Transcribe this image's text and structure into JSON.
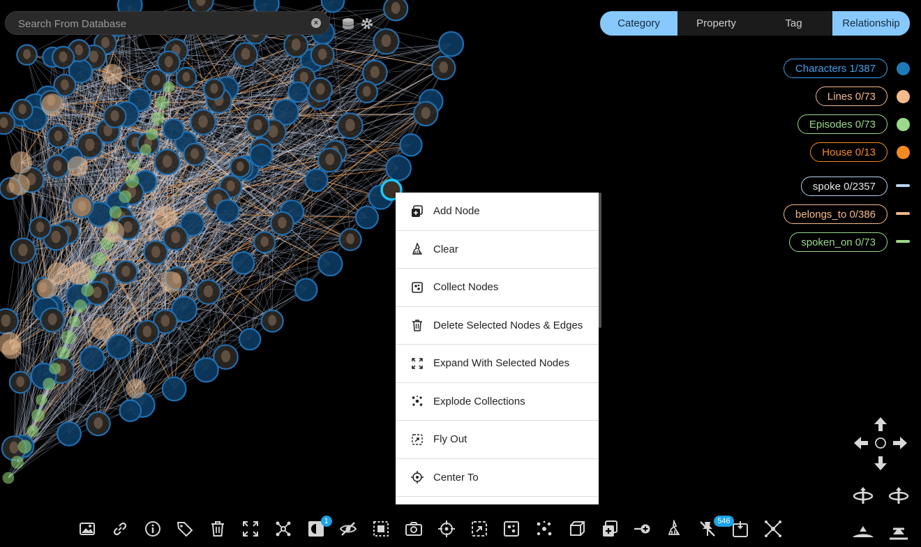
{
  "search": {
    "placeholder": "Search From Database"
  },
  "tabs": [
    {
      "label": "Category",
      "active": true
    },
    {
      "label": "Property",
      "active": false
    },
    {
      "label": "Tag",
      "active": false
    },
    {
      "label": "Relationship",
      "active": true
    }
  ],
  "legend": {
    "categories": [
      {
        "label": "Characters 1/387",
        "color": "#1e7ab8",
        "text_color": "#3ea2ee"
      },
      {
        "label": "Lines 0/73",
        "color": "#f6b98a",
        "text_color": "#f6b98a"
      },
      {
        "label": "Episodes 0/73",
        "color": "#9bd88a",
        "text_color": "#9bd88a"
      },
      {
        "label": "House 0/13",
        "color": "#f58a20",
        "text_color": "#f58a20"
      }
    ],
    "relationships": [
      {
        "label": "spoke 0/2357",
        "color": "#b9d4f2",
        "text_color": "#e6e6e6"
      },
      {
        "label": "belongs_to 0/386",
        "color": "#f6b98a",
        "text_color": "#f6b98a"
      },
      {
        "label": "spoken_on 0/73",
        "color": "#9bd88a",
        "text_color": "#9bd88a"
      }
    ]
  },
  "context_menu": {
    "items": [
      {
        "label": "Add Node",
        "icon": "add-node-icon"
      },
      {
        "label": "Clear",
        "icon": "broom-icon"
      },
      {
        "label": "Collect Nodes",
        "icon": "collect-icon"
      },
      {
        "label": "Delete Selected Nodes & Edges",
        "icon": "trash-icon"
      },
      {
        "label": "Expand With Selected Nodes",
        "icon": "expand-icon"
      },
      {
        "label": "Explode Collections",
        "icon": "explode-icon"
      },
      {
        "label": "Fly Out",
        "icon": "fly-out-icon"
      },
      {
        "label": "Center To",
        "icon": "crosshair-icon"
      }
    ]
  },
  "toolbar": {
    "items": [
      "image-icon",
      "link-icon",
      "info-icon",
      "tag-icon",
      "trash-icon",
      "fullscreen-icon",
      "network-icon",
      "contrast-icon",
      "hide-icon",
      "select-icon",
      "camera-icon",
      "crosshair-icon",
      "fly-out-icon",
      "collect-icon",
      "explode-icon",
      "cube-icon",
      "add-node-icon",
      "add-edge-icon",
      "broom-icon",
      "unpin-icon",
      "touch-icon",
      "expand-edges-icon"
    ],
    "contrast_badge": "1",
    "unpin_badge": "546"
  },
  "colors": {
    "character_fill": "#0c3a60",
    "character_stroke": "#1f6fb2",
    "line_fill": "#e8b88a",
    "episode_fill": "#8bcc6e",
    "edge": "#c9d8f0",
    "edge_orange": "#e09550",
    "selected": "#19c8ff"
  }
}
